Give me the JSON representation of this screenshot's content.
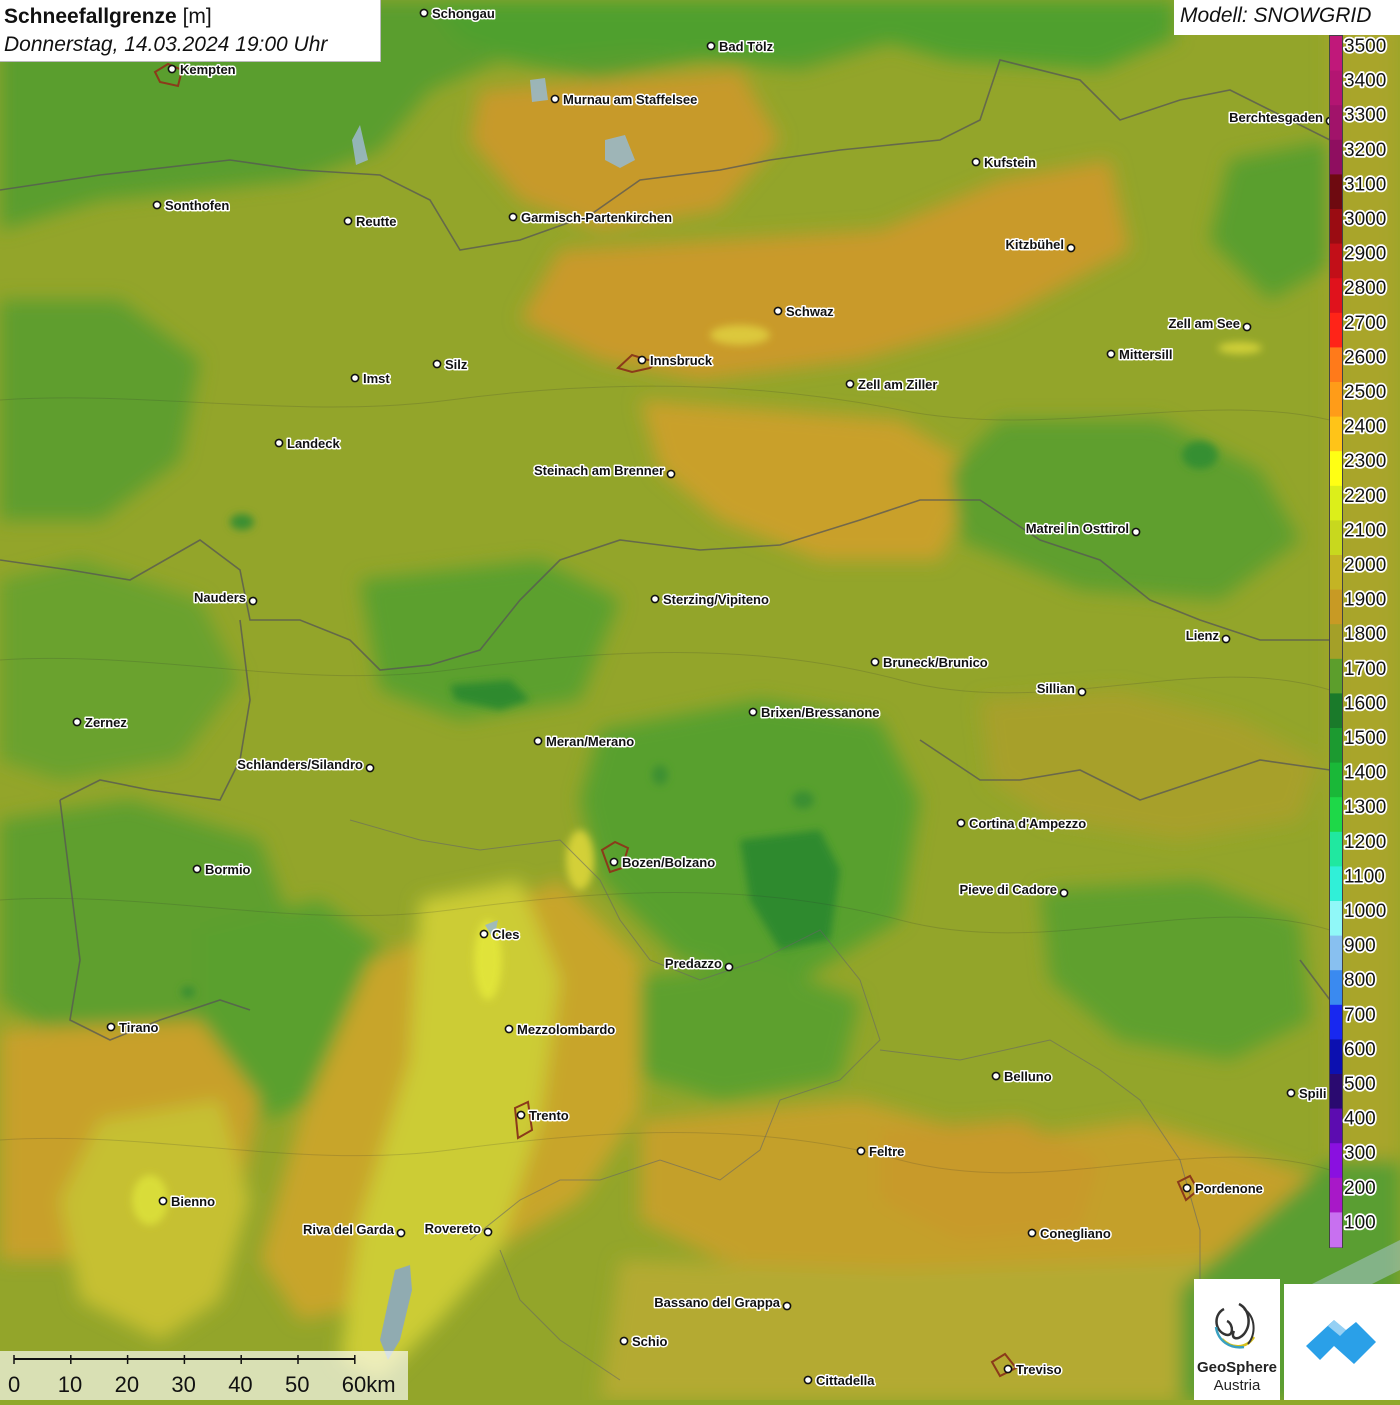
{
  "header": {
    "title_bold": "Schneefallgrenze",
    "title_unit": "[m]",
    "subtitle": "Donnerstag, 14.03.2024 19:00 Uhr",
    "model": "Modell: SNOWGRID"
  },
  "legend": {
    "levels": [
      {
        "value": "3500",
        "color": "#c0187a"
      },
      {
        "value": "3400",
        "color": "#b31572"
      },
      {
        "value": "3300",
        "color": "#a1136a"
      },
      {
        "value": "3200",
        "color": "#8f0e60"
      },
      {
        "value": "3100",
        "color": "#6e0a10"
      },
      {
        "value": "3000",
        "color": "#9a0c12"
      },
      {
        "value": "2900",
        "color": "#c20f18"
      },
      {
        "value": "2800",
        "color": "#e0121c"
      },
      {
        "value": "2700",
        "color": "#ff2418"
      },
      {
        "value": "2600",
        "color": "#ff7a1a"
      },
      {
        "value": "2500",
        "color": "#ff9c18"
      },
      {
        "value": "2400",
        "color": "#ffc418"
      },
      {
        "value": "2300",
        "color": "#ffff14"
      },
      {
        "value": "2200",
        "color": "#dcef1a"
      },
      {
        "value": "2100",
        "color": "#c8d81e"
      },
      {
        "value": "2000",
        "color": "#c4b424"
      },
      {
        "value": "1900",
        "color": "#c89a24"
      },
      {
        "value": "1800",
        "color": "#a4a028"
      },
      {
        "value": "1700",
        "color": "#5c9e2c"
      },
      {
        "value": "1600",
        "color": "#1a7a2a"
      },
      {
        "value": "1500",
        "color": "#1c9a30"
      },
      {
        "value": "1400",
        "color": "#1ab838"
      },
      {
        "value": "1300",
        "color": "#1ed848"
      },
      {
        "value": "1200",
        "color": "#20e8a0"
      },
      {
        "value": "1100",
        "color": "#30f0d8"
      },
      {
        "value": "1000",
        "color": "#90f8f8"
      },
      {
        "value": "900",
        "color": "#88c0f0"
      },
      {
        "value": "800",
        "color": "#3a8af0"
      },
      {
        "value": "700",
        "color": "#1828f0"
      },
      {
        "value": "600",
        "color": "#0c10b0"
      },
      {
        "value": "500",
        "color": "#2a0a70"
      },
      {
        "value": "400",
        "color": "#5c0cb0"
      },
      {
        "value": "300",
        "color": "#8a10e0"
      },
      {
        "value": "200",
        "color": "#a818c8"
      },
      {
        "value": "100",
        "color": "#c870f0"
      }
    ]
  },
  "scale": {
    "ticks": [
      "0",
      "10",
      "20",
      "30",
      "40",
      "50",
      "60km"
    ]
  },
  "cities": [
    {
      "name": "Schongau",
      "side": "r"
    },
    {
      "name": "Kempten",
      "side": "r"
    },
    {
      "name": "Bad Tölz",
      "side": "r"
    },
    {
      "name": "Murnau am Staffelsee",
      "side": "r"
    },
    {
      "name": "Kufstein",
      "side": "r"
    },
    {
      "name": "Berchtesgaden",
      "side": "l"
    },
    {
      "name": "Sonthofen",
      "side": "r"
    },
    {
      "name": "Reutte",
      "side": "r"
    },
    {
      "name": "Garmisch-Partenkirchen",
      "side": "r"
    },
    {
      "name": "Kitzbühel",
      "side": "l"
    },
    {
      "name": "Schwaz",
      "side": "r"
    },
    {
      "name": "Zell am See",
      "side": "l"
    },
    {
      "name": "Innsbruck",
      "side": "r"
    },
    {
      "name": "Silz",
      "side": "r"
    },
    {
      "name": "Mittersill",
      "side": "r"
    },
    {
      "name": "Imst",
      "side": "r"
    },
    {
      "name": "Zell am Ziller",
      "side": "r"
    },
    {
      "name": "Landeck",
      "side": "r"
    },
    {
      "name": "Steinach am Brenner",
      "side": "l"
    },
    {
      "name": "Matrei in Osttirol",
      "side": "l"
    },
    {
      "name": "Nauders",
      "side": "l"
    },
    {
      "name": "Sterzing/Vipiteno",
      "side": "r"
    },
    {
      "name": "Lienz",
      "side": "l"
    },
    {
      "name": "Bruneck/Brunico",
      "side": "r"
    },
    {
      "name": "Sillian",
      "side": "l"
    },
    {
      "name": "Brixen/Bressanone",
      "side": "r"
    },
    {
      "name": "Zernez",
      "side": "r"
    },
    {
      "name": "Meran/Merano",
      "side": "r"
    },
    {
      "name": "Schlanders/Silandro",
      "side": "l"
    },
    {
      "name": "Cortina d'Ampezzo",
      "side": "r"
    },
    {
      "name": "Bozen/Bolzano",
      "side": "r"
    },
    {
      "name": "Bormio",
      "side": "r"
    },
    {
      "name": "Pieve di Cadore",
      "side": "l"
    },
    {
      "name": "Cles",
      "side": "r"
    },
    {
      "name": "Predazzo",
      "side": "l"
    },
    {
      "name": "Tirano",
      "side": "r"
    },
    {
      "name": "Mezzolombardo",
      "side": "r"
    },
    {
      "name": "Belluno",
      "side": "r"
    },
    {
      "name": "Spili",
      "side": "r"
    },
    {
      "name": "Trento",
      "side": "r"
    },
    {
      "name": "Feltre",
      "side": "r"
    },
    {
      "name": "Pordenone",
      "side": "r"
    },
    {
      "name": "Bienno",
      "side": "r"
    },
    {
      "name": "Riva del Garda",
      "side": "l"
    },
    {
      "name": "Rovereto",
      "side": "l"
    },
    {
      "name": "Conegliano",
      "side": "r"
    },
    {
      "name": "Bassano del Grappa",
      "side": "l"
    },
    {
      "name": "Schio",
      "side": "r"
    },
    {
      "name": "Treviso",
      "side": "r"
    },
    {
      "name": "Cittadella",
      "side": "r"
    }
  ],
  "logos": {
    "geosphere_line1": "GeoSphere",
    "geosphere_line2": "Austria"
  }
}
